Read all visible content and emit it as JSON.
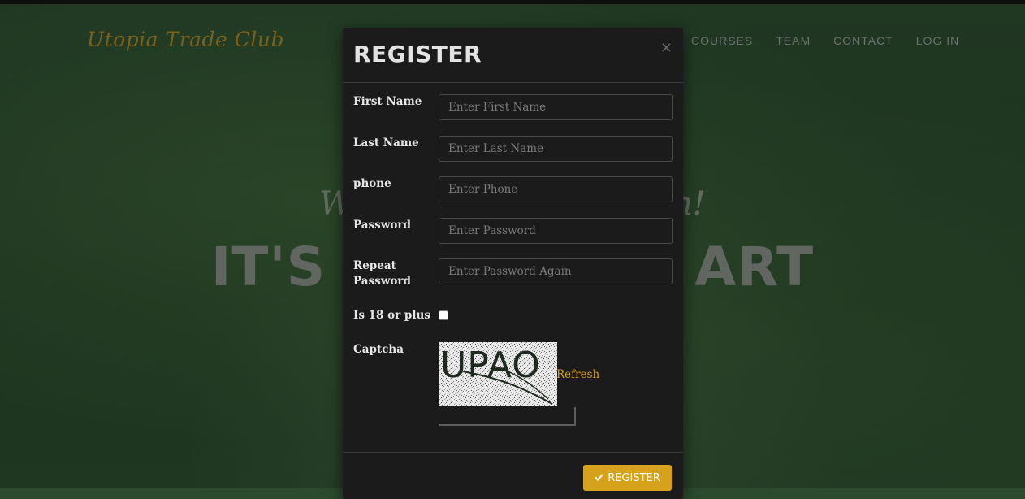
{
  "brand": "Utopia Trade Club",
  "nav": [
    "COURSES",
    "TEAM",
    "CONTACT",
    "LOG IN"
  ],
  "hero": {
    "subtitle_left": "W",
    "subtitle_right": "n!",
    "title_left": "IT'S",
    "title_right": "ART"
  },
  "modal": {
    "title": "REGISTER",
    "close": "×",
    "fields": {
      "first_name": {
        "label": "First Name",
        "placeholder": "Enter First Name"
      },
      "last_name": {
        "label": "Last Name",
        "placeholder": "Enter Last Name"
      },
      "phone": {
        "label": "phone",
        "placeholder": "Enter Phone"
      },
      "password": {
        "label": "Password",
        "placeholder": "Enter Password"
      },
      "repeat_password": {
        "label": "Repeat Password",
        "placeholder": "Enter Password Again"
      },
      "is_adult": {
        "label": "Is 18 or plus"
      },
      "captcha": {
        "label": "Captcha",
        "image_text": "UPAO",
        "refresh": "Refresh"
      }
    },
    "submit_label": "REGISTER",
    "submit_icon": "check-icon"
  },
  "colors": {
    "accent": "#d6a21c",
    "brand": "#b08a2a",
    "modal_bg": "#1b1b1c",
    "board": "#2b4a2e"
  }
}
